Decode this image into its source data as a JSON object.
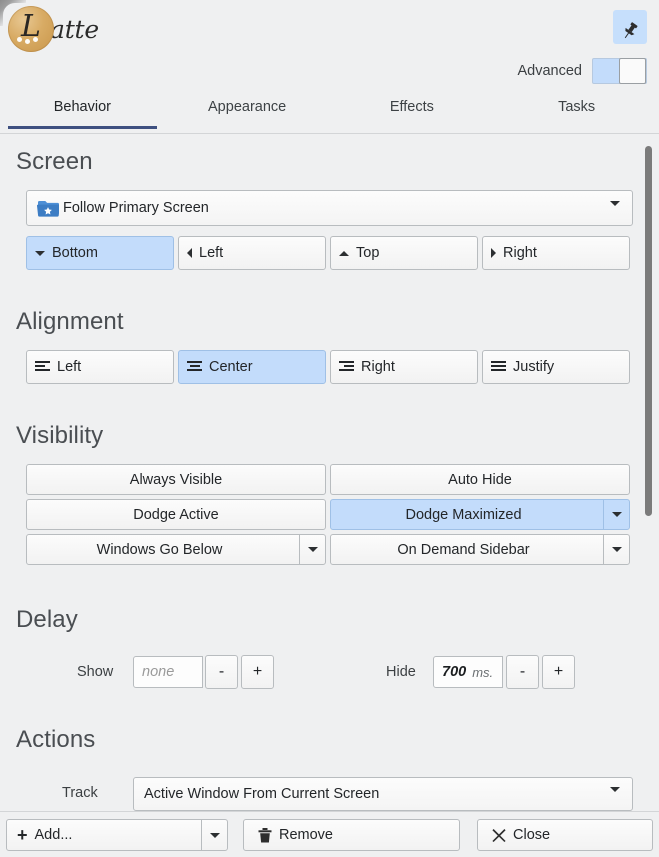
{
  "window": {
    "app_name": "Latte",
    "logo_letter": "L",
    "logo_rest": "atte"
  },
  "header": {
    "pin_icon": "pushpin-icon",
    "advanced_label": "Advanced",
    "advanced_enabled": false
  },
  "tabs": [
    {
      "label": "Behavior",
      "active": true
    },
    {
      "label": "Appearance",
      "active": false
    },
    {
      "label": "Effects",
      "active": false
    },
    {
      "label": "Tasks",
      "active": false
    }
  ],
  "sections": {
    "screen": {
      "title": "Screen",
      "combo": {
        "value": "Follow Primary Screen",
        "icon": "folder-star-icon"
      },
      "edges": [
        {
          "label": "Bottom",
          "icon": "arrow-down-icon",
          "selected": true
        },
        {
          "label": "Left",
          "icon": "arrow-left-icon",
          "selected": false
        },
        {
          "label": "Top",
          "icon": "arrow-up-icon",
          "selected": false
        },
        {
          "label": "Right",
          "icon": "arrow-right-icon",
          "selected": false
        }
      ]
    },
    "alignment": {
      "title": "Alignment",
      "options": [
        {
          "label": "Left",
          "icon": "align-left-icon",
          "selected": false
        },
        {
          "label": "Center",
          "icon": "align-center-icon",
          "selected": true
        },
        {
          "label": "Right",
          "icon": "align-right-icon",
          "selected": false
        },
        {
          "label": "Justify",
          "icon": "align-justify-icon",
          "selected": false
        }
      ]
    },
    "visibility": {
      "title": "Visibility",
      "options": [
        {
          "label": "Always Visible",
          "selected": false,
          "has_menu": false
        },
        {
          "label": "Auto Hide",
          "selected": false,
          "has_menu": false
        },
        {
          "label": "Dodge Active",
          "selected": false,
          "has_menu": false
        },
        {
          "label": "Dodge Maximized",
          "selected": true,
          "has_menu": true
        },
        {
          "label": "Windows Go Below",
          "selected": false,
          "has_menu": true
        },
        {
          "label": "On Demand Sidebar",
          "selected": false,
          "has_menu": true
        }
      ]
    },
    "delay": {
      "title": "Delay",
      "show": {
        "label": "Show",
        "value": "",
        "placeholder": "none",
        "unit": "",
        "decrement": "-",
        "increment": "+"
      },
      "hide": {
        "label": "Hide",
        "value": "700",
        "placeholder": "",
        "unit": "ms.",
        "decrement": "-",
        "increment": "+"
      }
    },
    "actions": {
      "title": "Actions",
      "track": {
        "label": "Track",
        "value": "Active Window From Current Screen"
      }
    }
  },
  "bottom_bar": {
    "add": {
      "label": "Add...",
      "icon": "plus-icon",
      "menu_icon": "chevron-down-icon"
    },
    "remove": {
      "label": "Remove",
      "icon": "trash-icon"
    },
    "close": {
      "label": "Close",
      "icon": "close-x-icon"
    }
  },
  "scroll": {
    "thumb_top_pct": 1,
    "thumb_height_pct": 55
  },
  "colors": {
    "window_bg": "#eff0f1",
    "selection": "#c3dcfb",
    "accent": "#3e5080",
    "border": "#b8bcbf",
    "brand_gold": "#d8ab64"
  }
}
